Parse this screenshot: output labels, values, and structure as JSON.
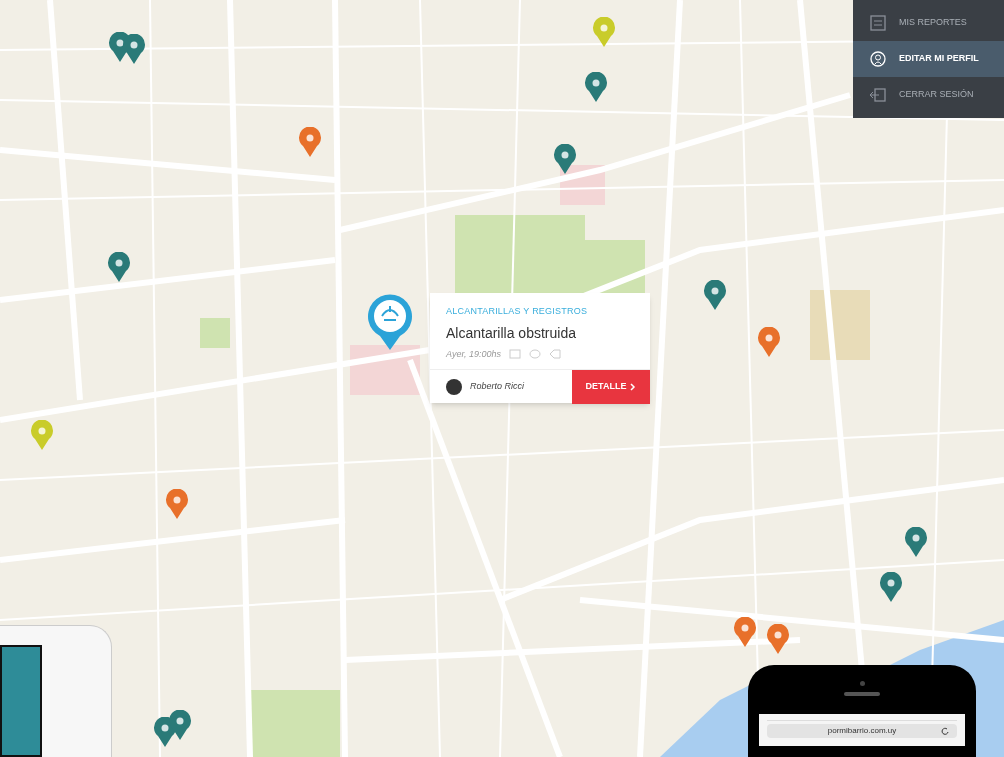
{
  "user_menu": {
    "items": [
      {
        "label": "MIS REPORTES",
        "kind": "reports",
        "selected": false
      },
      {
        "label": "EDITAR MI PERFIL",
        "kind": "profile",
        "selected": true
      },
      {
        "label": "CERRAR SESIÓN",
        "kind": "logout",
        "selected": false
      }
    ]
  },
  "pins": [
    {
      "color": "#2a7a78"
    },
    {
      "color": "#2a7a78"
    },
    {
      "color": "#2a7a78"
    },
    {
      "color": "#2a7a78"
    },
    {
      "color": "#2a7a78"
    },
    {
      "color": "#2a7a78"
    },
    {
      "color": "#2a7a78"
    },
    {
      "color": "#2a7a78"
    },
    {
      "color": "#2a7a78"
    },
    {
      "color": "#2a7a78"
    },
    {
      "color": "#e8702a"
    },
    {
      "color": "#e8702a"
    },
    {
      "color": "#e8702a"
    },
    {
      "color": "#e8702a"
    },
    {
      "color": "#e8702a"
    },
    {
      "color": "#c9cc2a"
    },
    {
      "color": "#c9cc2a"
    }
  ],
  "report_popup": {
    "category": "ALCANTARILLAS Y REGISTROS",
    "title": "Alcantarilla obstruida",
    "time": "Ayer, 19:00hs",
    "author": "Roberto Ricci",
    "button": "DETALLE"
  },
  "phone": {
    "address": "pormibarrio.com.uy"
  }
}
